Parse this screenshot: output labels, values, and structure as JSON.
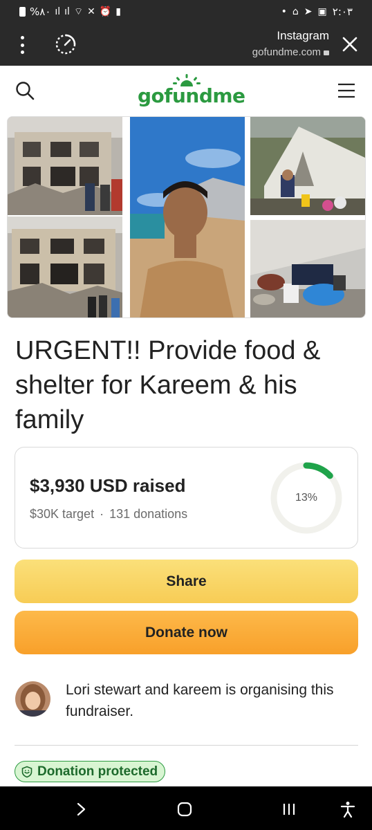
{
  "status_bar": {
    "left_text": "%٨٠",
    "time": "٢:٠٣"
  },
  "browser": {
    "app_name": "Instagram",
    "url": "gofundme.com"
  },
  "site": {
    "logo_text": "gofundme"
  },
  "campaign": {
    "title": "URGENT!! Provide food & shelter for Kareem & his family",
    "raised": "$3,930 USD raised",
    "target": "$30K target",
    "separator": "·",
    "donations": "131 donations",
    "percent_label": "13%",
    "progress_fraction": 0.13
  },
  "buttons": {
    "share": "Share",
    "donate": "Donate now"
  },
  "organiser": {
    "text": "Lori stewart and kareem is organising this fundraiser."
  },
  "badge": {
    "protected": "Donation protected"
  },
  "colors": {
    "brand_green": "#2b9a40",
    "share_yellow": "#f7cc55",
    "donate_orange": "#f8a02a",
    "progress_green": "#1fa34a"
  }
}
